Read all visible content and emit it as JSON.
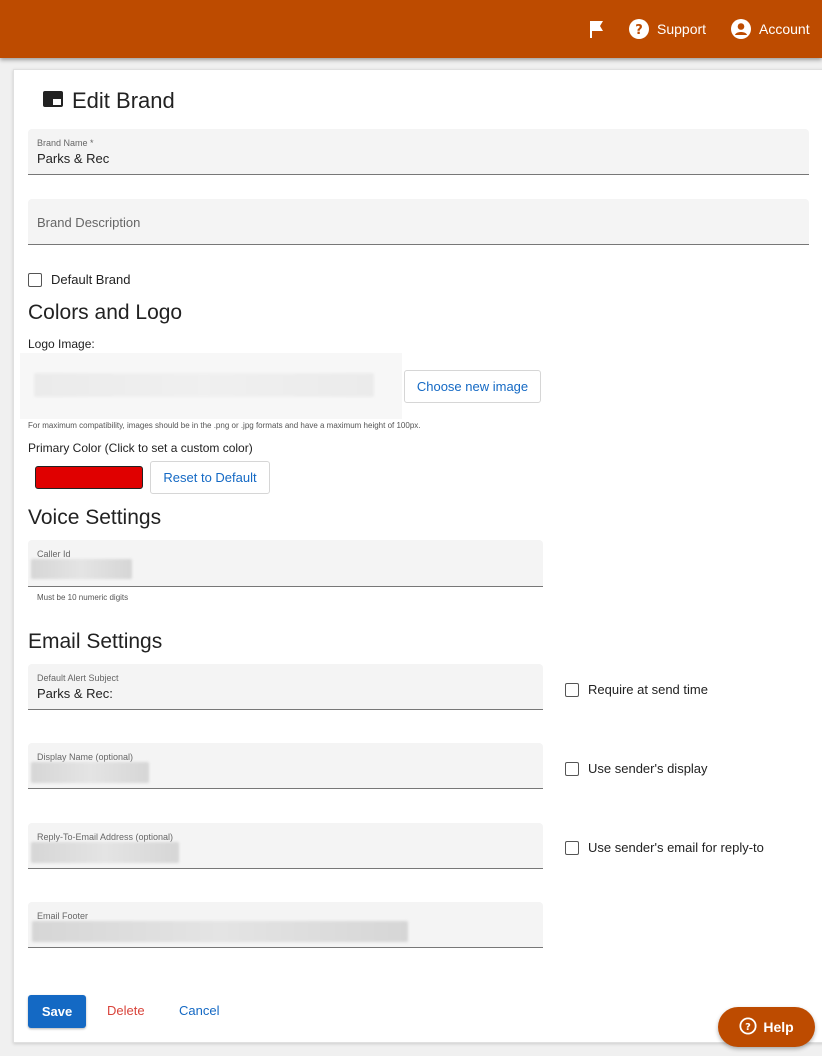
{
  "header": {
    "support_label": "Support",
    "account_label": "Account",
    "bar_color": "#bd4b00",
    "icons": [
      "flag-icon",
      "help-circle-icon",
      "account-circle-icon"
    ]
  },
  "page": {
    "title": "Edit Brand",
    "title_icon": "brand-card-icon"
  },
  "form": {
    "brand_name": {
      "label": "Brand Name *",
      "value": "Parks & Rec"
    },
    "brand_description": {
      "placeholder": "Brand Description"
    },
    "default_brand": {
      "label": "Default Brand",
      "checked": false
    }
  },
  "colors_logo": {
    "heading": "Colors and Logo",
    "logo_label": "Logo Image:",
    "choose_image_label": "Choose new image",
    "logo_hint": "For maximum compatibility, images should be in the .png or .jpg formats and have a maximum height of 100px.",
    "primary_color_label": "Primary Color (Click to set a custom color)",
    "primary_color": "#e00000",
    "reset_label": "Reset to Default"
  },
  "voice": {
    "heading": "Voice Settings",
    "caller_id_label": "Caller Id",
    "caller_id_hint": "Must be 10 numeric digits"
  },
  "email": {
    "heading": "Email Settings",
    "subject_label": "Default Alert Subject",
    "subject_value": "Parks & Rec:",
    "require_label": "Require at send time",
    "display_name_label": "Display Name (optional)",
    "use_display_label": "Use sender's display",
    "reply_to_label": "Reply-To-Email Address (optional)",
    "use_reply_label": "Use sender's email for reply-to",
    "footer_label": "Email Footer"
  },
  "actions": {
    "save_label": "Save",
    "delete_label": "Delete",
    "cancel_label": "Cancel",
    "primary_color": "#1469c4",
    "delete_color": "#d9443b"
  },
  "help": {
    "label": "Help"
  }
}
